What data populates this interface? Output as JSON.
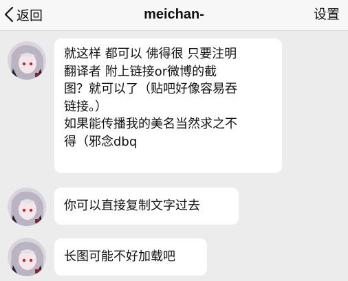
{
  "nav": {
    "back_label": "返回",
    "title": "meichan-",
    "settings_label": "设置"
  },
  "messages": [
    {
      "lines": [
        "就这样 都可以 佛得很 只要注明",
        "翻译者 附上链接or微博的截",
        "图？就可以了（贴吧好像容易吞",
        "链接。）",
        "如果能传播我的美名当然求之不",
        "得（邪念dbq"
      ]
    },
    {
      "lines": [
        "你可以直接复制文字过去"
      ]
    },
    {
      "lines": [
        "长图可能不好加载吧"
      ]
    }
  ]
}
